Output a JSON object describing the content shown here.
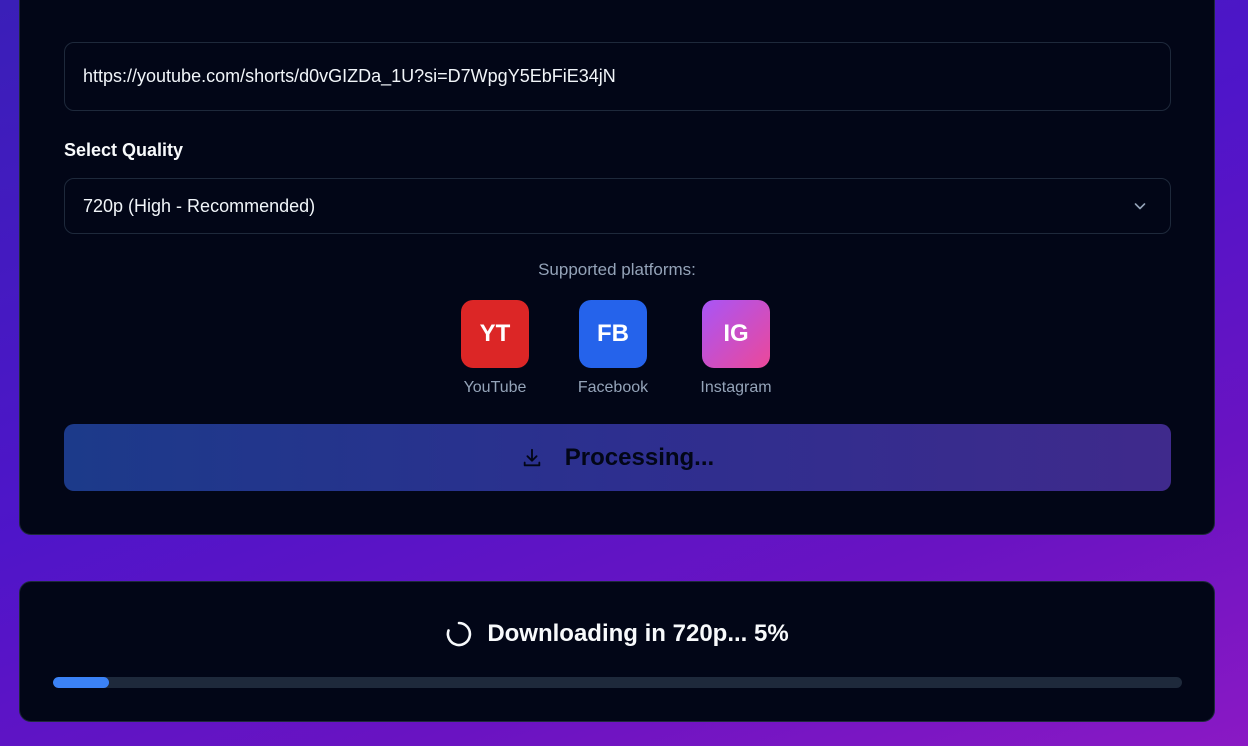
{
  "form": {
    "url_value": "https://youtube.com/shorts/d0vGIZDa_1U?si=D7WpgY5EbFiE34jN",
    "quality_label": "Select Quality",
    "quality_selected": "720p (High - Recommended)",
    "chevron_icon": "chevron-down-icon"
  },
  "platforms": {
    "title": "Supported platforms:",
    "items": [
      {
        "abbr": "YT",
        "name": "YouTube",
        "color": "#dc2626"
      },
      {
        "abbr": "FB",
        "name": "Facebook",
        "color": "#2563eb"
      },
      {
        "abbr": "IG",
        "name": "Instagram",
        "color": "#a855f7"
      }
    ]
  },
  "action": {
    "button_label": "Processing...",
    "icon": "download-icon"
  },
  "progress": {
    "status_text": "Downloading in 720p... 5%",
    "percent": 5,
    "icon": "spinner-icon",
    "accent": "#3b82f6"
  }
}
